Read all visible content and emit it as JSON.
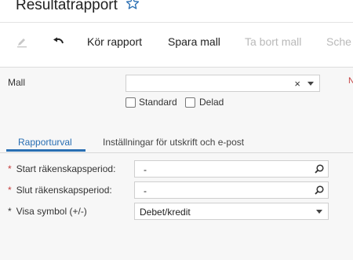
{
  "header": {
    "title": "Resultatrapport"
  },
  "toolbar": {
    "run_label": "Kör rapport",
    "save_template_label": "Spara mall",
    "delete_template_label": "Ta bort mall",
    "schedule_label": "Sche"
  },
  "template": {
    "label": "Mall",
    "value": "",
    "clear_glyph": "×",
    "standard_label": "Standard",
    "shared_label": "Delad",
    "cut_label": "N"
  },
  "tabs": [
    {
      "label": "Rapporturval"
    },
    {
      "label": "Inställningar för utskrift och e-post"
    }
  ],
  "params": {
    "start_period": {
      "label": "Start räkenskapsperiod:",
      "value": "-"
    },
    "end_period": {
      "label": "Slut räkenskapsperiod:",
      "value": "-"
    },
    "symbol": {
      "label": "Visa symbol (+/-)",
      "value": "Debet/kredit"
    }
  },
  "colors": {
    "accent": "#2a6fb3",
    "required": "#c43c3c"
  }
}
